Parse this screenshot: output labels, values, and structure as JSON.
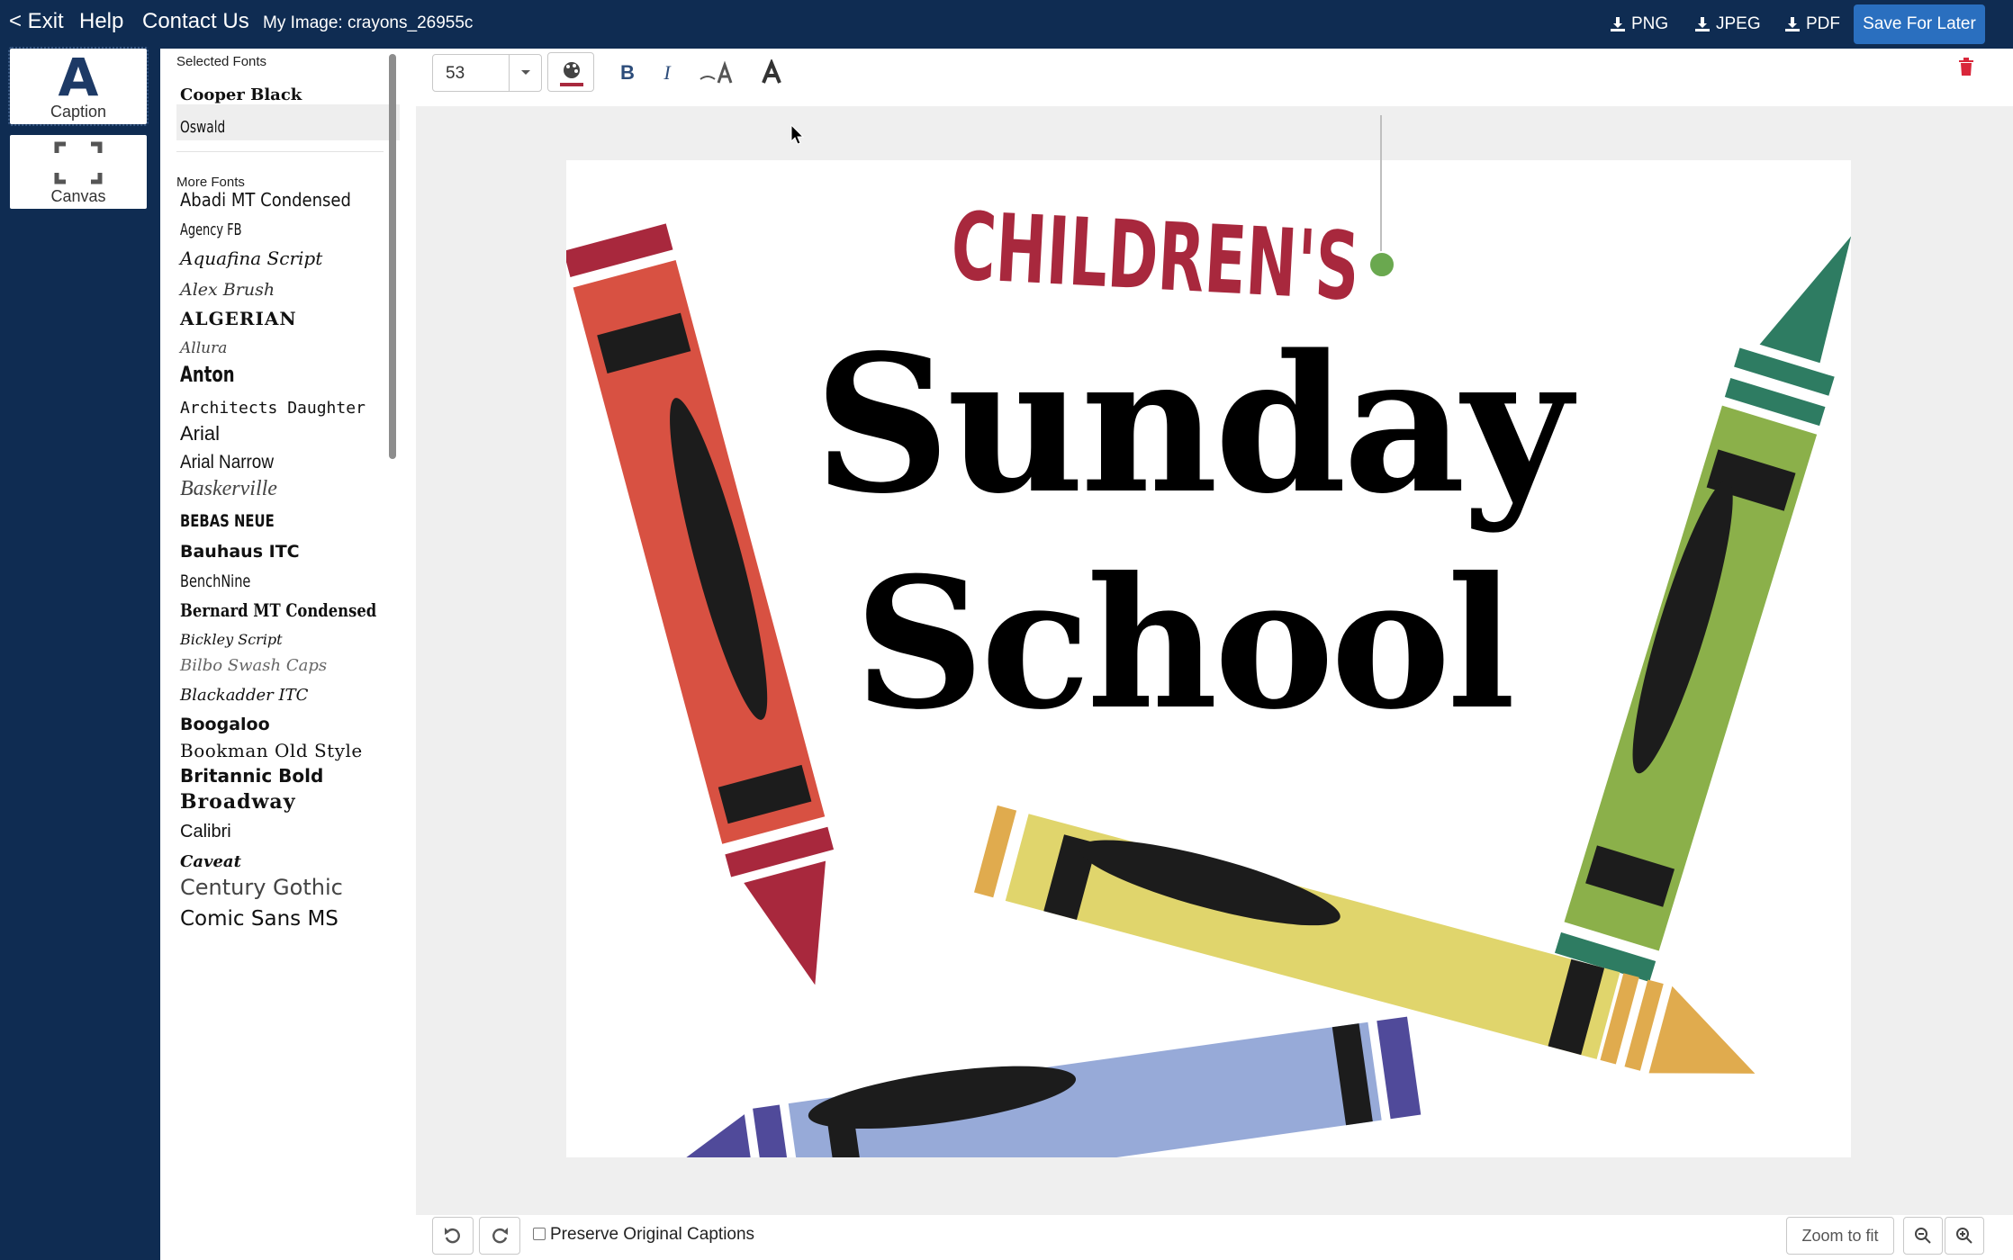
{
  "topbar": {
    "exit": "< Exit",
    "help": "Help",
    "contact": "Contact Us",
    "image_title": "My Image: crayons_26955c",
    "png": "PNG",
    "jpeg": "JPEG",
    "pdf": "PDF",
    "save": "Save For Later"
  },
  "rail": {
    "caption_icon": "A",
    "caption": "Caption",
    "canvas": "Canvas"
  },
  "fonts": {
    "selected_header": "Selected Fonts",
    "selected": [
      "Cooper Black",
      "Oswald"
    ],
    "more_header": "More Fonts",
    "more": [
      "Abadi MT Condensed",
      "Agency FB",
      "Aquafina Script",
      "Alex Brush",
      "ALGERIAN",
      "Allura",
      "Anton",
      "Architects Daughter",
      "Arial",
      "Arial Narrow",
      "Baskerville",
      "BEBAS NEUE",
      "Bauhaus ITC",
      "BenchNine",
      "Bernard MT Condensed",
      "Bickley Script",
      "Bilbo Swash Caps",
      "Blackadder ITC",
      "Boogaloo",
      "Bookman Old Style",
      "Britannic Bold",
      "Broadway",
      "Calibri",
      "Caveat",
      "Century Gothic",
      "Comic Sans MS"
    ]
  },
  "toolbar": {
    "font_size": "53",
    "bold": "B",
    "italic": "I"
  },
  "canvas": {
    "line1": "CHILDREN'S",
    "line2": "Sunday",
    "line3": "School"
  },
  "bottom": {
    "preserve": "Preserve Original Captions",
    "zoom_fit": "Zoom to fit"
  },
  "colors": {
    "nav_bg": "#0f2c52",
    "save_btn": "#2a6fbf",
    "caption_red": "#a8283d",
    "delete_red": "#d9263a"
  }
}
